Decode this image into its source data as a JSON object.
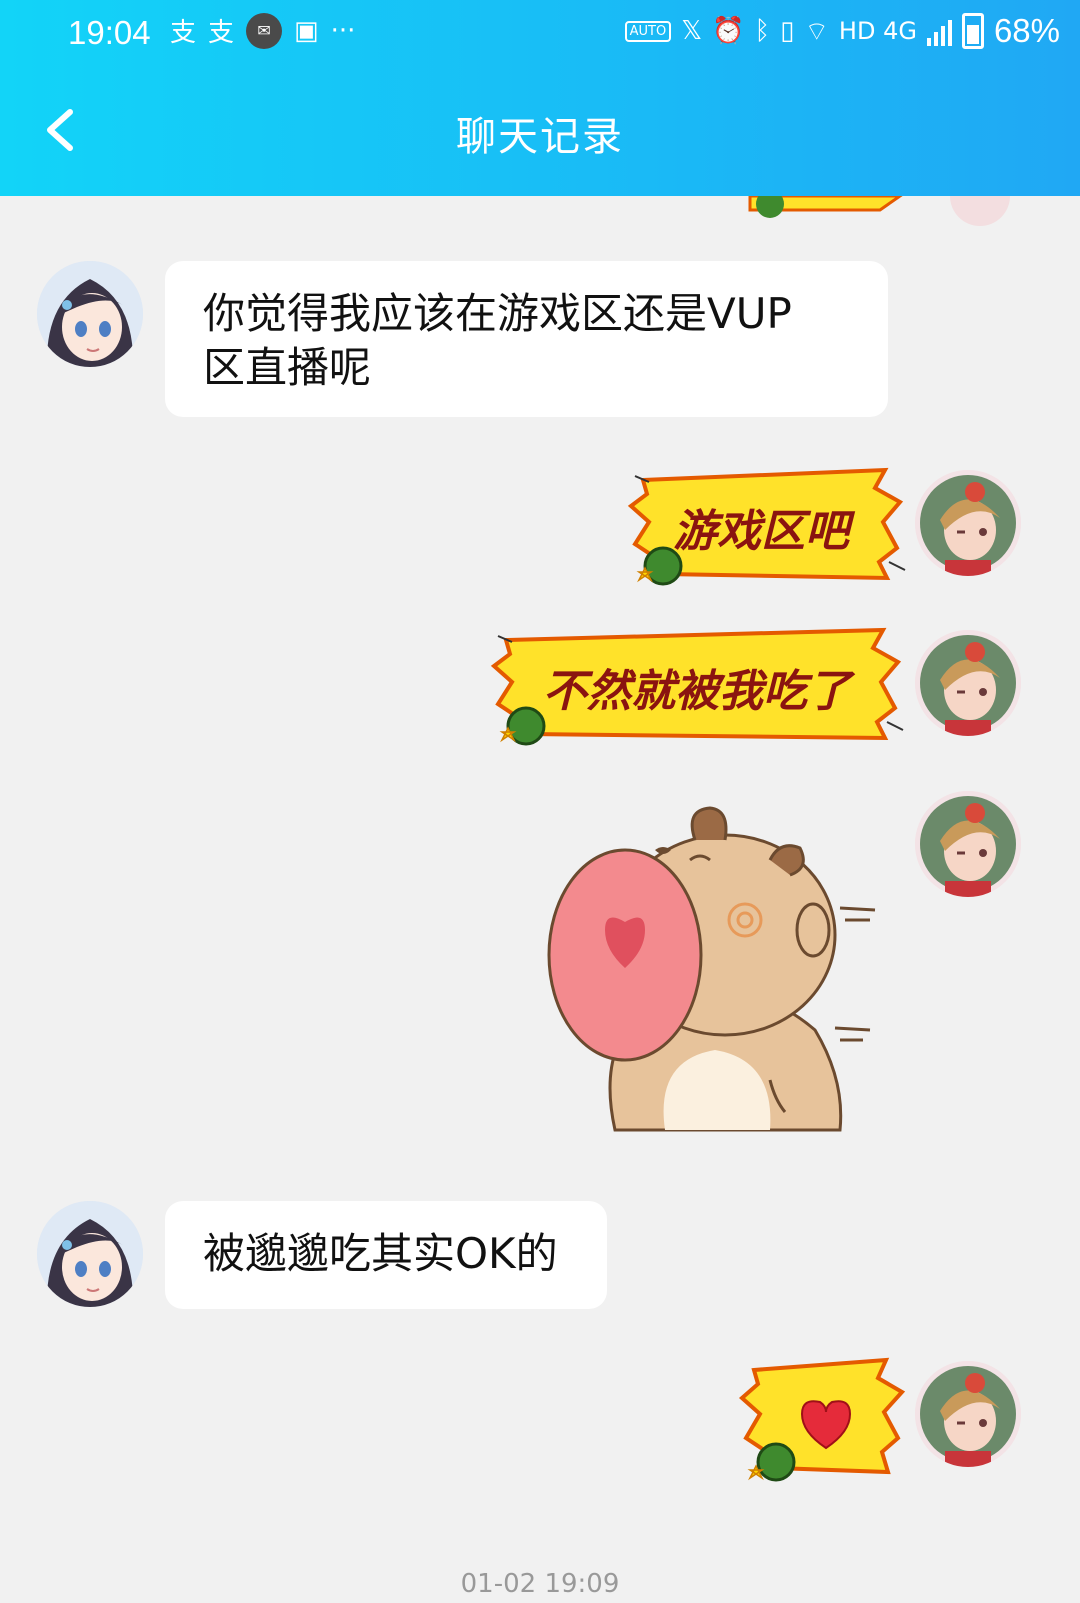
{
  "status_bar": {
    "time": "19:04",
    "network": "HD 4G",
    "battery": "68%",
    "refresh_badge": "AUTO"
  },
  "header": {
    "title": "聊天记录"
  },
  "messages": [
    {
      "side": "left",
      "type": "text",
      "text": "你觉得我应该在游戏区还是VUP区直播呢",
      "line1": "你觉得我应该在游戏区还是VUP",
      "line2": "区直播呢"
    },
    {
      "side": "right",
      "type": "sticker-text",
      "text": "游戏区吧"
    },
    {
      "side": "right",
      "type": "sticker-text",
      "text": "不然就被我吃了"
    },
    {
      "side": "right",
      "type": "sticker-image",
      "name": "bear-eating-heart"
    },
    {
      "side": "left",
      "type": "text",
      "text": "被邈邈吃其实OK的"
    },
    {
      "side": "right",
      "type": "sticker-heart",
      "name": "heart"
    }
  ],
  "footer_timestamp": "01-02 19:09",
  "colors": {
    "header_start": "#12d4f8",
    "header_end": "#20a8f4",
    "sticker_yellow": "#ffe22a",
    "sticker_text": "#8a1410"
  }
}
